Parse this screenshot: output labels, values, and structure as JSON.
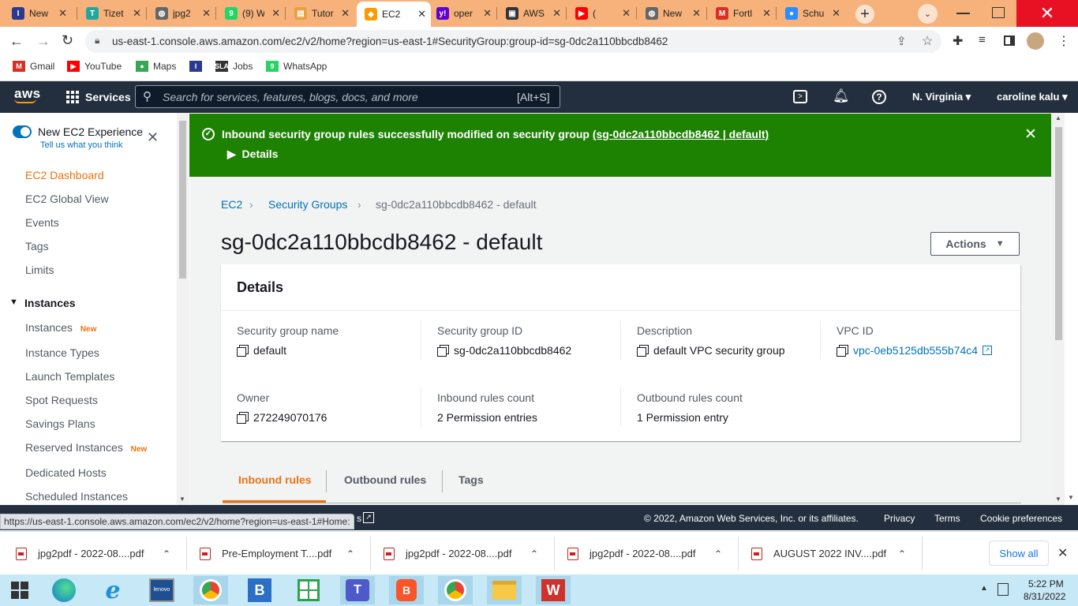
{
  "browser": {
    "tabs": [
      {
        "label": "New",
        "icon": "indeed-icon",
        "color": "#2b3990",
        "glyph": "I",
        "active": false
      },
      {
        "label": "Tizet",
        "icon": "tizeti-icon",
        "color": "#22a7a0",
        "glyph": "T",
        "active": false
      },
      {
        "label": "jpg2",
        "icon": "globe-icon",
        "color": "#666666",
        "glyph": "◍",
        "active": false
      },
      {
        "label": "(9) W",
        "icon": "whatsapp-icon",
        "color": "#25d366",
        "glyph": "9",
        "active": false
      },
      {
        "label": "Tutor",
        "icon": "tutorial-icon",
        "color": "#e9a23b",
        "glyph": "▤",
        "active": false
      },
      {
        "label": "EC2",
        "icon": "aws-cube-icon",
        "color": "#f90",
        "glyph": "◆",
        "active": true
      },
      {
        "label": "oper",
        "icon": "yahoo-icon",
        "color": "#6001d2",
        "glyph": "y!",
        "active": false
      },
      {
        "label": "AWS",
        "icon": "terminal-icon",
        "color": "#333333",
        "glyph": "▣",
        "active": false
      },
      {
        "label": "(",
        "icon": "youtube-icon",
        "color": "#ff0000",
        "glyph": "▶",
        "active": false
      },
      {
        "label": "New",
        "icon": "globe-icon",
        "color": "#666666",
        "glyph": "◍",
        "active": false
      },
      {
        "label": "Fortl",
        "icon": "gmail-icon",
        "color": "#d93025",
        "glyph": "M",
        "active": false
      },
      {
        "label": "Schu",
        "icon": "zoom-icon",
        "color": "#2d8cff",
        "glyph": "●",
        "active": false
      }
    ],
    "url": "us-east-1.console.aws.amazon.com/ec2/v2/home?region=us-east-1#SecurityGroup:group-id=sg-0dc2a110bbcdb8462",
    "bookmarks": [
      {
        "label": "Gmail",
        "icon": "gmail-icon",
        "color": "#d93025",
        "glyph": "M"
      },
      {
        "label": "YouTube",
        "icon": "youtube-icon",
        "color": "#ff0000",
        "glyph": "▶"
      },
      {
        "label": "Maps",
        "icon": "maps-pin-icon",
        "color": "#34a853",
        "glyph": "●"
      },
      {
        "label": "",
        "icon": "indeed-icon",
        "color": "#2b3990",
        "glyph": "I"
      },
      {
        "label": "Jobs",
        "icon": "jobs-icon",
        "color": "#333333",
        "glyph": "SLA"
      },
      {
        "label": "WhatsApp",
        "icon": "whatsapp-icon",
        "color": "#25d366",
        "glyph": "9"
      }
    ],
    "status_url": "https://us-east-1.console.aws.amazon.com/ec2/v2/home?region=us-east-1#Home:"
  },
  "awsnav": {
    "logo": "aws",
    "services": "Services",
    "search_placeholder": "Search for services, features, blogs, docs, and more",
    "search_shortcut": "[Alt+S]",
    "region": "N. Virginia",
    "user": "caroline kalu"
  },
  "sidebar": {
    "toggle_label": "New EC2 Experience",
    "toggle_sub": "Tell us what you think",
    "items": [
      {
        "label": "EC2 Dashboard",
        "active": true
      },
      {
        "label": "EC2 Global View"
      },
      {
        "label": "Events"
      },
      {
        "label": "Tags"
      },
      {
        "label": "Limits"
      }
    ],
    "section": "Instances",
    "section_items": [
      {
        "label": "Instances",
        "badge": "New"
      },
      {
        "label": "Instance Types"
      },
      {
        "label": "Launch Templates"
      },
      {
        "label": "Spot Requests"
      },
      {
        "label": "Savings Plans"
      },
      {
        "label": "Reserved Instances",
        "badge": "New"
      },
      {
        "label": "Dedicated Hosts"
      },
      {
        "label": "Scheduled Instances"
      }
    ]
  },
  "flash": {
    "message": "Inbound security group rules successfully modified on security group",
    "link": "(sg-0dc2a110bbcdb8462 | default)",
    "details": "Details"
  },
  "breadcrumb": [
    "EC2",
    "Security Groups",
    "sg-0dc2a110bbcdb8462 - default"
  ],
  "page_title": "sg-0dc2a110bbcdb8462 - default",
  "actions_label": "Actions",
  "details": {
    "header": "Details",
    "fields": {
      "sg_name": {
        "label": "Security group name",
        "value": "default"
      },
      "sg_id": {
        "label": "Security group ID",
        "value": "sg-0dc2a110bbcdb8462"
      },
      "description": {
        "label": "Description",
        "value": "default VPC security group"
      },
      "vpc": {
        "label": "VPC ID",
        "value": "vpc-0eb5125db555b74c4"
      },
      "owner": {
        "label": "Owner",
        "value": "272249070176"
      },
      "inbound": {
        "label": "Inbound rules count",
        "value": "2 Permission entries"
      },
      "outbound": {
        "label": "Outbound rules count",
        "value": "1 Permission entry"
      }
    }
  },
  "tabs": [
    "Inbound rules",
    "Outbound rules",
    "Tags"
  ],
  "footer": {
    "copyright": "© 2022, Amazon Web Services, Inc. or its affiliates.",
    "privacy": "Privacy",
    "terms": "Terms",
    "cookies": "Cookie preferences",
    "partial": "s"
  },
  "downloads": {
    "items": [
      "jpg2pdf - 2022-08....pdf",
      "Pre-Employment T....pdf",
      "jpg2pdf - 2022-08....pdf",
      "jpg2pdf - 2022-08....pdf",
      "AUGUST 2022 INV....pdf"
    ],
    "show_all": "Show all"
  },
  "taskbar": {
    "time": "5:22 PM",
    "date": "8/31/2022"
  },
  "colors": {
    "aws_nav": "#232f3e",
    "flash_green": "#1d8102",
    "link": "#0073bb",
    "active_orange": "#ec7211",
    "tab_strip": "#f6b27a"
  }
}
